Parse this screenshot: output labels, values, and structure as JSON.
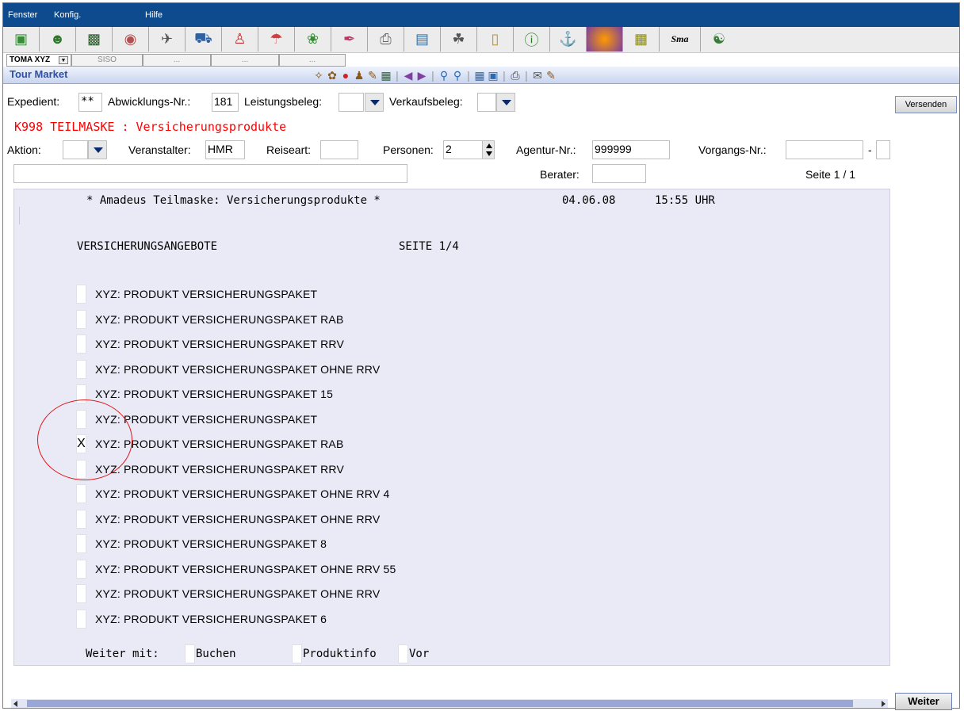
{
  "menu": {
    "fenster": "Fenster",
    "konfig": "Konfig.",
    "hilfe": "Hilfe"
  },
  "toolbar": {
    "icons": [
      "app-icon",
      "home-icon",
      "monitor-icon",
      "user-icon",
      "flight-icon",
      "car-icon",
      "hotel-porter-icon",
      "umbrella-icon",
      "map-icon",
      "ticket-icon",
      "printer-icon",
      "document-icon",
      "trolley-icon",
      "folder-icon",
      "info-icon",
      "ship-icon",
      "sun-icon",
      "calendar-icon",
      "smart-icon",
      "globe-icon"
    ],
    "smart_label": "Sma"
  },
  "tabs": {
    "active": "TOMA XYZ",
    "siso": "SISO",
    "blank1": "...",
    "blank2": "...",
    "blank3": "..."
  },
  "app_title": "Tour Market",
  "form": {
    "expedient_label": "Expedient:",
    "expedient_value": "**",
    "abwicklung_label": "Abwicklungs-Nr.:",
    "abwicklung_value": "181",
    "leistungsbeleg_label": "Leistungsbeleg:",
    "leistungsbeleg_value": "",
    "verkaufsbeleg_label": "Verkaufsbeleg:",
    "verkaufsbeleg_value": "",
    "send_label": "Versenden",
    "mask_title": "K998 TEILMASKE : Versicherungsprodukte",
    "aktion_label": "Aktion:",
    "aktion_value": "",
    "veranstalter_label": "Veranstalter:",
    "veranstalter_value": "HMR",
    "reiseart_label": "Reiseart:",
    "reiseart_value": "",
    "personen_label": "Personen:",
    "personen_value": "2",
    "agentur_label": "Agentur-Nr.:",
    "agentur_value": "999999",
    "vorgang_label": "Vorgangs-Nr.:",
    "vorgang_value": "",
    "vorgang_sep": "-",
    "vorgang_suffix": "",
    "freetext_value": "",
    "berater_label": "Berater:",
    "berater_value": "",
    "seite_label": "Seite 1 / 1"
  },
  "terminal": {
    "header": "* Amadeus Teilmaske: Versicherungsprodukte *",
    "date": "04.06.08",
    "time": "15:55 UHR",
    "section_title": "VERSICHERUNGSANGEBOTE",
    "page": "SEITE 1/4",
    "products": [
      {
        "mark": "",
        "label": "XYZ: PRODUKT VERSICHERUNGSPAKET"
      },
      {
        "mark": "",
        "label": "XYZ: PRODUKT VERSICHERUNGSPAKET RAB"
      },
      {
        "mark": "",
        "label": "XYZ: PRODUKT VERSICHERUNGSPAKET RRV"
      },
      {
        "mark": "",
        "label": "XYZ: PRODUKT VERSICHERUNGSPAKET OHNE RRV"
      },
      {
        "mark": "",
        "label": "XYZ: PRODUKT VERSICHERUNGSPAKET 15"
      },
      {
        "mark": "",
        "label": "XYZ: PRODUKT VERSICHERUNGSPAKET"
      },
      {
        "mark": "X",
        "label": "XYZ: PRODUKT VERSICHERUNGSPAKET RAB"
      },
      {
        "mark": "",
        "label": "XYZ: PRODUKT VERSICHERUNGSPAKET RRV"
      },
      {
        "mark": "",
        "label": "XYZ: PRODUKT VERSICHERUNGSPAKET OHNE RRV 4"
      },
      {
        "mark": "",
        "label": "XYZ: PRODUKT VERSICHERUNGSPAKET OHNE RRV"
      },
      {
        "mark": "",
        "label": "XYZ: PRODUKT VERSICHERUNGSPAKET 8"
      },
      {
        "mark": "",
        "label": "XYZ: PRODUKT VERSICHERUNGSPAKET OHNE RRV 55"
      },
      {
        "mark": "",
        "label": "XYZ: PRODUKT VERSICHERUNGSPAKET OHNE RRV"
      },
      {
        "mark": "",
        "label": "XYZ: PRODUKT VERSICHERUNGSPAKET 6"
      }
    ],
    "weiter_mit": "Weiter mit:",
    "buchen": "Buchen",
    "produktinfo": "Produktinfo",
    "vor": "Vor"
  },
  "next_label": "Weiter",
  "colors": {
    "menubar": "#0e4b8e",
    "mask_title": "#ff0000",
    "terminal_bg": "#eaeaf6",
    "highlight_circle": "#e01818"
  }
}
